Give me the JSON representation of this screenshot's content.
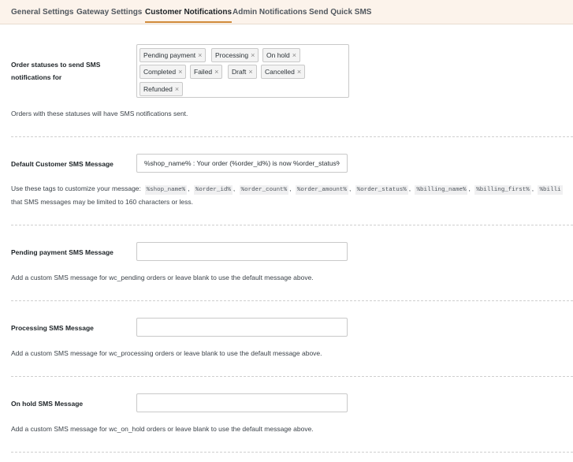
{
  "tabs": [
    {
      "label": "General Settings",
      "active": false
    },
    {
      "label": "Gateway Settings",
      "active": false
    },
    {
      "label": "Customer Notifications",
      "active": true
    },
    {
      "label": "Admin Notifications",
      "active": false
    },
    {
      "label": "Send Quick SMS",
      "active": false
    }
  ],
  "order_statuses": {
    "label": "Order statuses to send SMS notifications for",
    "label_line1": "Order statuses to send SMS",
    "label_line2": "notifications for",
    "selected": [
      "Pending payment",
      "Processing",
      "On hold",
      "Completed",
      "Failed",
      "Draft",
      "Cancelled",
      "Refunded"
    ],
    "remove_glyph": "×",
    "description": "Orders with these statuses will have SMS notifications sent."
  },
  "default_message": {
    "label": "Default Customer SMS Message",
    "value": "%shop_name% : Your order (%order_id%) is now %order_status%.",
    "desc_prefix": "Use these tags to customize your message:",
    "tags": [
      "%shop_name%",
      "%order_id%",
      "%order_count%",
      "%order_amount%",
      "%order_status%",
      "%billing_name%",
      "%billing_first%",
      "%billi"
    ],
    "desc_suffix": "that SMS messages may be limited to 160 characters or less."
  },
  "pending_message": {
    "label": "Pending payment SMS Message",
    "value": "",
    "description": "Add a custom SMS message for wc_pending orders or leave blank to use the default message above."
  },
  "processing_message": {
    "label": "Processing SMS Message",
    "value": "",
    "description": "Add a custom SMS message for wc_processing orders or leave blank to use the default message above."
  },
  "onhold_message": {
    "label": "On hold SMS Message",
    "value": "",
    "description": "Add a custom SMS message for wc_on_hold orders or leave blank to use the default message above."
  },
  "colors": {
    "tab_bar_bg": "#fcf3eb",
    "tab_active_underline": "#d08a3b",
    "text": "#2c3338"
  }
}
